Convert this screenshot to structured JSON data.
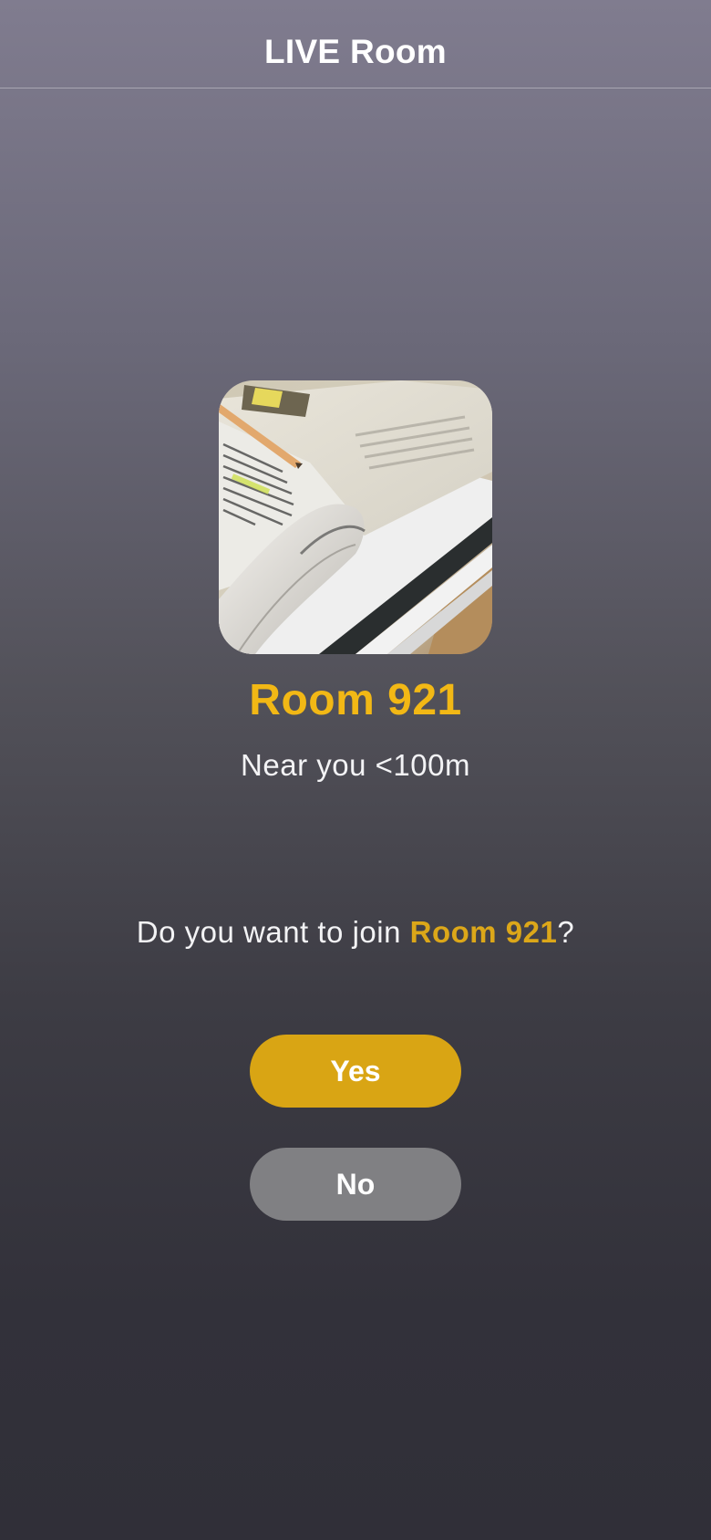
{
  "header": {
    "title": "LIVE Room"
  },
  "room": {
    "image_icon": "book-photo",
    "name": "Room 921",
    "distance": "Near you <100m"
  },
  "prompt": {
    "prefix": "Do you want to join ",
    "room_name": "Room 921",
    "suffix": "?"
  },
  "actions": {
    "yes_label": "Yes",
    "no_label": "No"
  },
  "colors": {
    "accent": "#f2b815",
    "yes_button": "#d9a514",
    "no_button": "#808083"
  }
}
